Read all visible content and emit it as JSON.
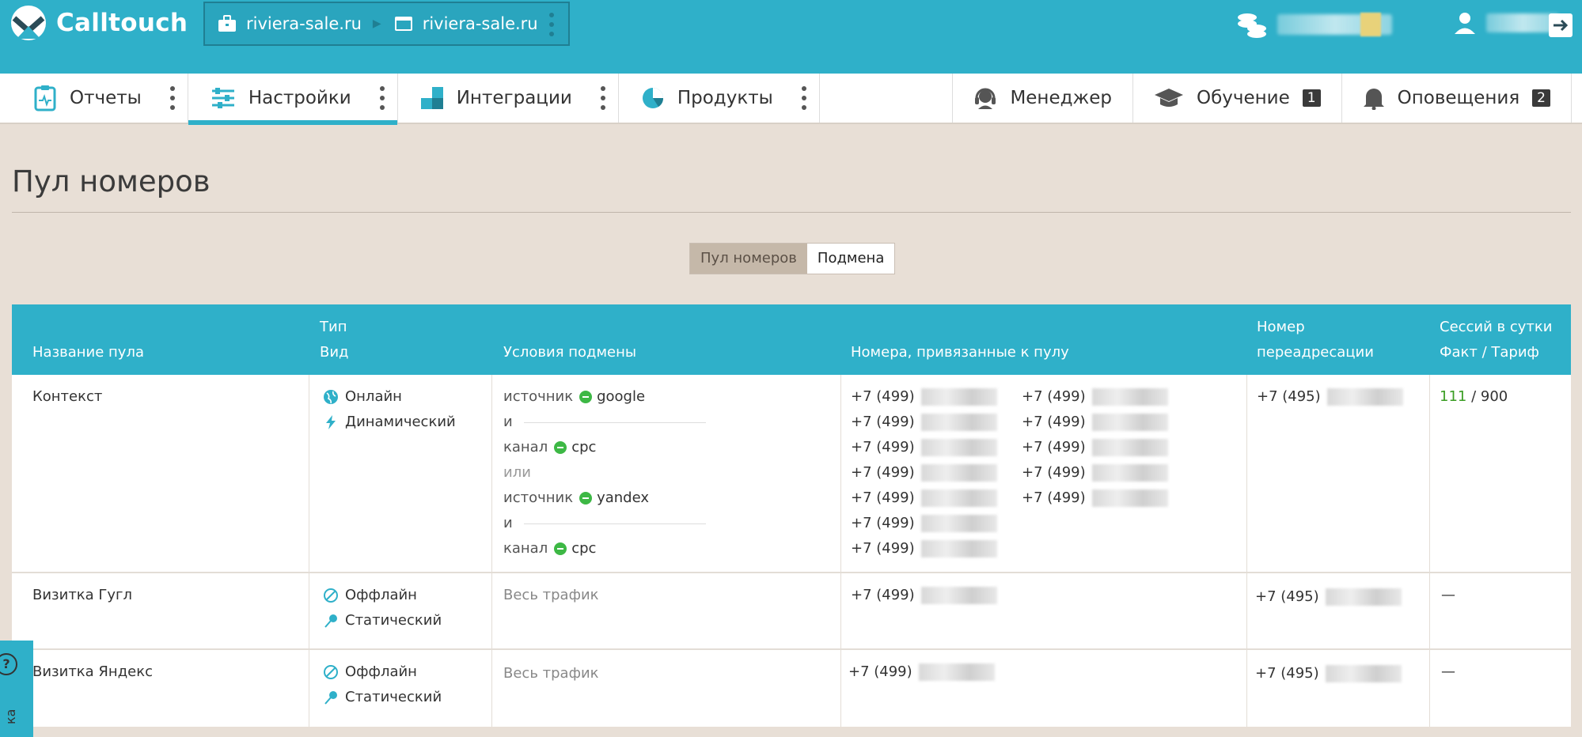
{
  "app": {
    "name": "Calltouch"
  },
  "site_switch": {
    "site_a": "riviera-sale.ru",
    "site_b": "riviera-sale.ru"
  },
  "nav": {
    "left": [
      {
        "label": "Отчеты",
        "icon": "clipboard-chart-icon"
      },
      {
        "label": "Настройки",
        "icon": "sliders-icon"
      },
      {
        "label": "Интеграции",
        "icon": "puzzle-icon"
      },
      {
        "label": "Продукты",
        "icon": "pie-icon"
      }
    ],
    "right": [
      {
        "label": "Менеджер",
        "icon": "headset-icon"
      },
      {
        "label": "Обучение",
        "icon": "graduation-cap-icon",
        "count": "1"
      },
      {
        "label": "Оповещения",
        "icon": "bell-icon",
        "count": "2"
      }
    ]
  },
  "page": {
    "title": "Пул номеров"
  },
  "segmented": {
    "pool": "Пул номеров",
    "substitution": "Подмена"
  },
  "table": {
    "headers": {
      "name": "Название пула",
      "type_top": "Тип",
      "type_bottom": "Вид",
      "conditions": "Условия подмены",
      "numbers": "Номера, привязанные к пулу",
      "redirect_top": "Номер",
      "redirect_bottom": "переадресации",
      "sessions_top": "Сессий в сутки",
      "sessions_bottom": "Факт / Тариф"
    },
    "rows": [
      {
        "name": "Контекст",
        "type": "Онлайн",
        "kind": "Динамический",
        "conditions": {
          "k1": "источник",
          "v1": "google",
          "and1": "и",
          "k2": "канал",
          "v2": "cpc",
          "or": "или",
          "k3": "источник",
          "v3": "yandex",
          "and2": "и",
          "k4": "канал",
          "v4": "cpc"
        },
        "phone_prefix": "+7 (499)",
        "redirect_prefix": "+7 (495)",
        "fact": "111",
        "tariff": "900",
        "slash": "/"
      },
      {
        "name": "Визитка Гугл",
        "type": "Оффлайн",
        "kind": "Статический",
        "conditions_text": "Весь трафик",
        "phone_prefix": "+7 (499)",
        "redirect_prefix": "+7 (495)",
        "sessions": "—"
      },
      {
        "name": "Визитка Яндекс",
        "type": "Оффлайн",
        "kind": "Статический",
        "conditions_text": "Весь трафик",
        "phone_prefix": "+7 (499)",
        "redirect_prefix": "+7 (495)",
        "sessions": "—"
      }
    ]
  },
  "help": {
    "symbol": "?",
    "label": "ка"
  }
}
